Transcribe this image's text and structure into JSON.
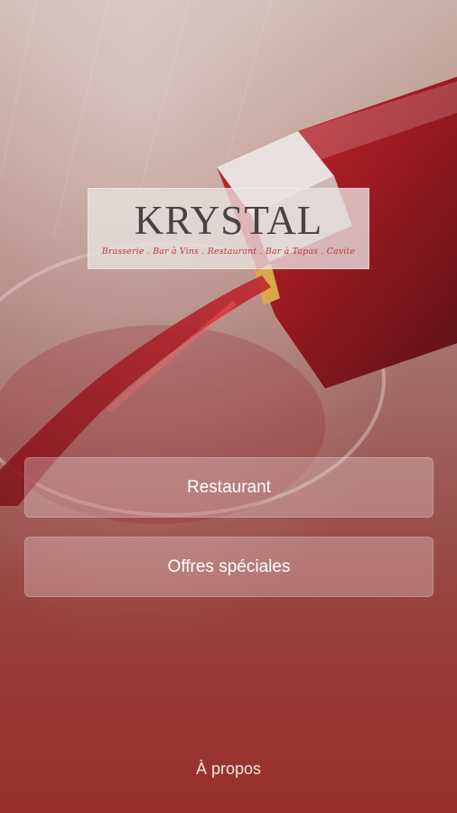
{
  "logo": {
    "title": "KRYSTAL",
    "tagline": "Brasserie . Bar à Vins . Restaurant . Bar à Tapas . Cavite"
  },
  "menu": {
    "restaurant_label": "Restaurant",
    "offers_label": "Offres spéciales"
  },
  "footer": {
    "about_label": "À propos"
  },
  "colors": {
    "wine_red": "#982f2c",
    "logo_text": "#494244",
    "tagline_red": "#b53a3a"
  }
}
